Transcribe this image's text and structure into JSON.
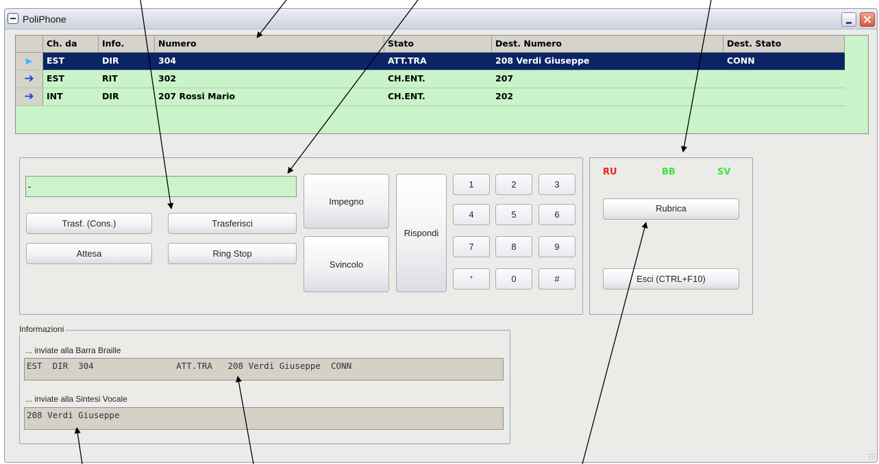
{
  "window": {
    "title": "PoliPhone"
  },
  "grid": {
    "columns": [
      "Ch. da",
      "Info.",
      "Numero",
      "Stato",
      "Dest. Numero",
      "Dest. Stato"
    ],
    "rows": [
      {
        "indicator": "▶",
        "ch_da": "EST",
        "info": "DIR",
        "numero": "304",
        "stato": "ATT.TRA",
        "dest_numero": "208 Verdi Giuseppe",
        "dest_stato": "CONN",
        "selected": true
      },
      {
        "indicator": "➔",
        "ch_da": "EST",
        "info": "RIT",
        "numero": "302",
        "stato": "CH.ENT.",
        "dest_numero": "207",
        "dest_stato": ""
      },
      {
        "indicator": "➔",
        "ch_da": "INT",
        "info": "DIR",
        "numero": "207 Rossi Mario",
        "stato": "CH.ENT.",
        "dest_numero": "202",
        "dest_stato": ""
      }
    ]
  },
  "controls": {
    "entry_value": "-",
    "trasf_cons": "Trasf. (Cons.)",
    "trasferisci": "Trasferisci",
    "attesa": "Attesa",
    "ring_stop": "Ring Stop",
    "impegno": "Impegno",
    "svincolo": "Svincolo",
    "rispondi": "Rispondi",
    "keys": [
      "1",
      "2",
      "3",
      "4",
      "5",
      "6",
      "7",
      "8",
      "9",
      "*",
      "0",
      "#"
    ]
  },
  "status": {
    "ru": "RU",
    "bb": "BB",
    "sv": "SV",
    "colors": {
      "ru": "#e8231f",
      "bb": "#3be33b",
      "sv": "#3be33b"
    },
    "rubrica": "Rubrica",
    "esci": "Esci (CTRL+F10)"
  },
  "info": {
    "legend": "Informazioni",
    "braille_label": "... inviate alla Barra Braille",
    "braille_text": "EST  DIR  304                ATT.TRA   208 Verdi Giuseppe  CONN",
    "speech_label": "... inviate alla Sintesi Vocale",
    "speech_text": "208 Verdi Giuseppe"
  }
}
